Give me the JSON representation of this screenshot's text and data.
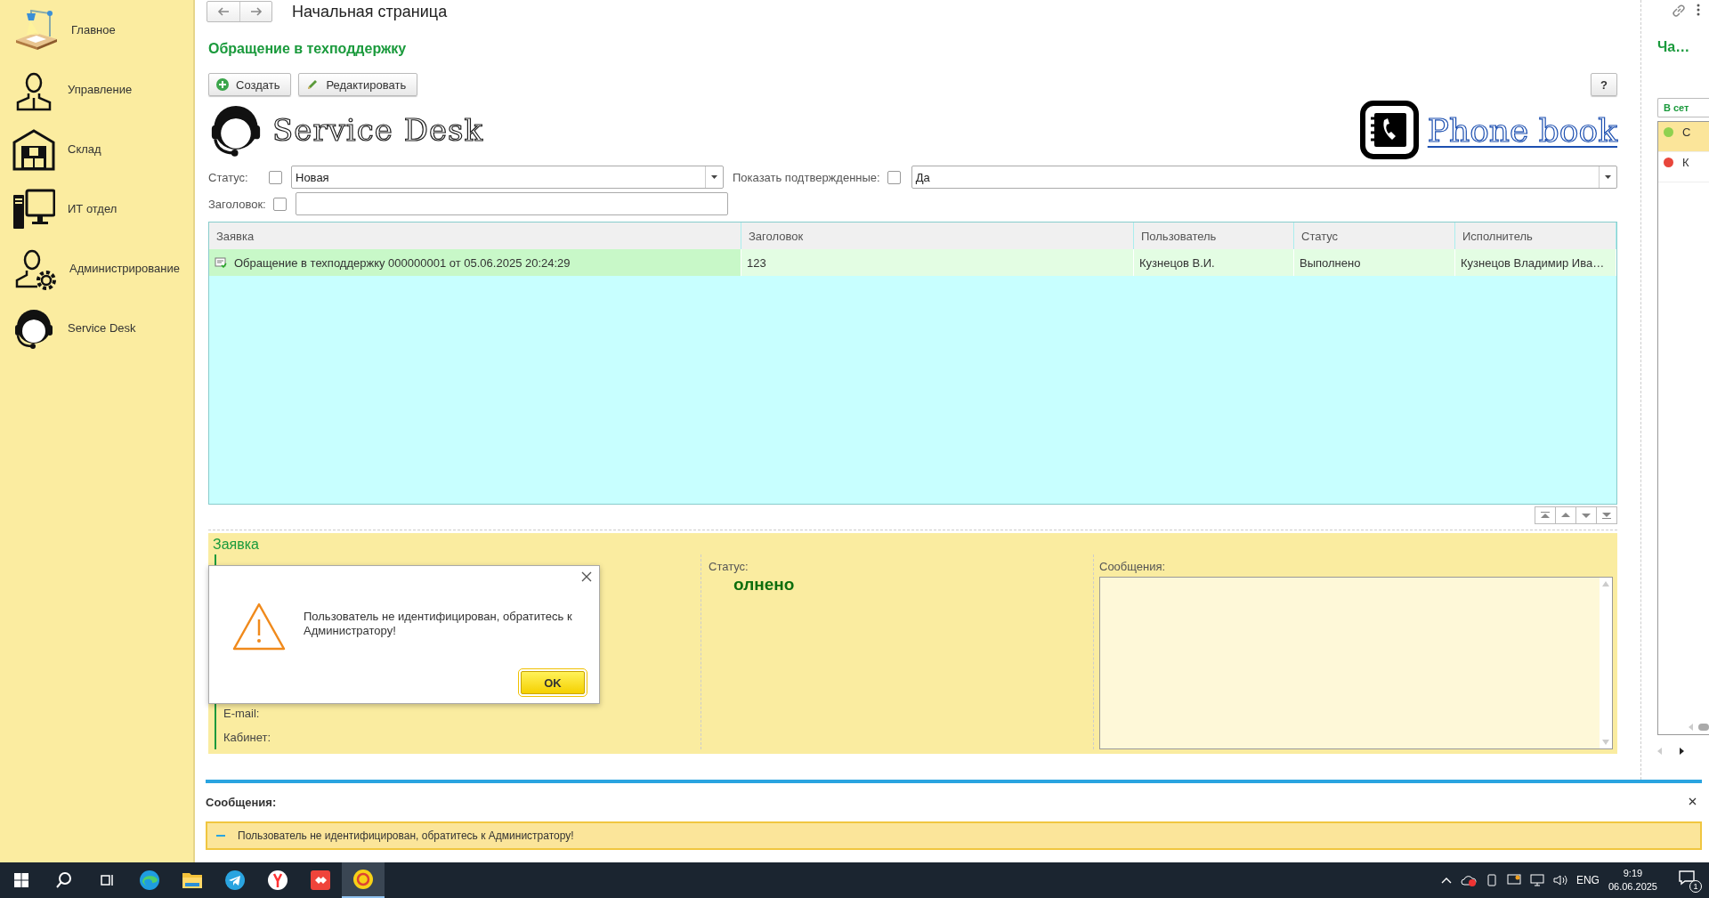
{
  "sidebar": {
    "items": [
      {
        "label": "Главное",
        "kind": "lamp"
      },
      {
        "label": "Управление",
        "kind": "manager"
      },
      {
        "label": "Склад",
        "kind": "warehouse"
      },
      {
        "label": "ИТ отдел",
        "kind": "computer"
      },
      {
        "label": "Администрирование",
        "kind": "admin"
      },
      {
        "label": "Service Desk",
        "kind": "operator"
      }
    ]
  },
  "header": {
    "title": "Начальная страница"
  },
  "form": {
    "title": "Обращение в техподдержку",
    "buttons": [
      {
        "label": "Создать",
        "kind": "create"
      },
      {
        "label": "Редактировать",
        "kind": "edit"
      }
    ],
    "help": "?",
    "logos": [
      {
        "label": "Service Desk",
        "kind": "operator"
      },
      {
        "label": "Phone book",
        "kind": "phonebook"
      }
    ],
    "filters": {
      "status": {
        "label": "Статус:",
        "checked": false,
        "value": "Новая"
      },
      "confirmed": {
        "label": "Показать подтвержденные:",
        "checked": false,
        "value": "Да"
      },
      "heading": {
        "label": "Заголовок:",
        "checked": false
      }
    },
    "table": {
      "columns": [
        "Заявка",
        "Заголовок",
        "Пользователь",
        "Статус",
        "Исполнитель"
      ],
      "rows": [
        {
          "selected": true,
          "cells": [
            "Обращение в техподдержку 000000001 от 05.06.2025 20:24:29",
            "123",
            "Кузнецов В.И.",
            "Выполнено",
            "Кузнецов Владимир Ива…"
          ]
        }
      ]
    },
    "detail": {
      "title": "Заявка",
      "fields": [
        "E-mail:",
        "Кабинет:"
      ],
      "status_label": "Статус:",
      "status_value": "олнено",
      "messages_label": "Сообщения:"
    },
    "dialog": {
      "text": "Пользователь не идентифицирован, обратитесь к Администратору!",
      "button": "OK"
    }
  },
  "side_panel": {
    "title": "Ча…",
    "button": "В сет",
    "items": [
      {
        "label": "С",
        "color": "#8fd14f",
        "selected": true
      },
      {
        "label": "К",
        "color": "#e8463b",
        "selected": false
      }
    ]
  },
  "messages": {
    "title": "Сообщения:",
    "items": [
      "Пользователь не идентифицирован, обратитесь к Администратору!"
    ]
  },
  "taskbar": {
    "apps": [
      {
        "kind": "edge",
        "selected": false
      },
      {
        "kind": "folder",
        "selected": false
      },
      {
        "kind": "telegram",
        "selected": false
      },
      {
        "kind": "yandex",
        "selected": false
      },
      {
        "kind": "remote",
        "selected": false
      },
      {
        "kind": "onec",
        "selected": true
      }
    ],
    "language": "ENG",
    "time": "9:19",
    "date": "06.06.2025",
    "notifications": "1"
  }
}
